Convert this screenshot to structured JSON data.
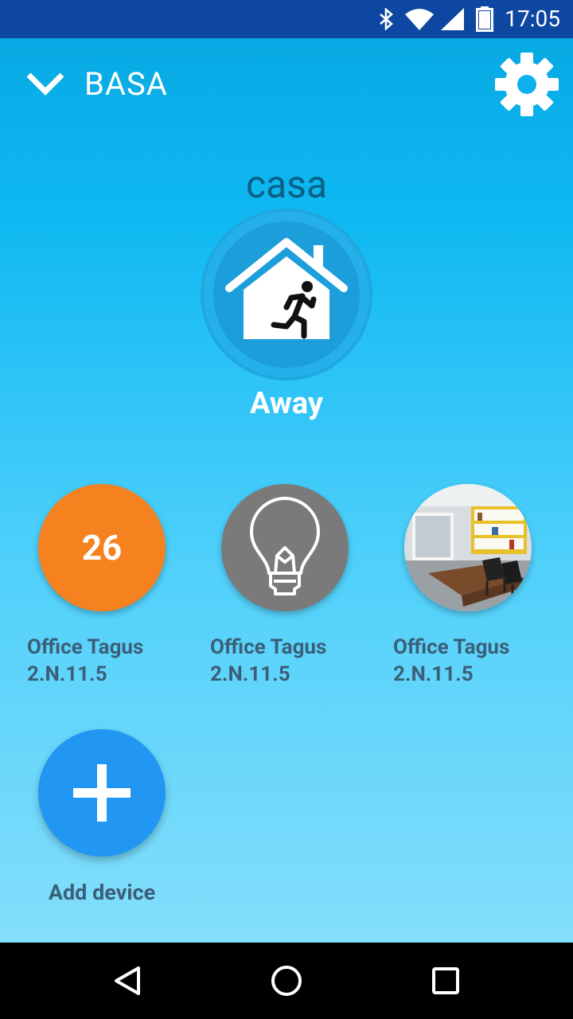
{
  "status_bar": {
    "time": "17:05"
  },
  "header": {
    "home_name": "BASA"
  },
  "place": {
    "name": "casa",
    "mode_label": "Away"
  },
  "devices": [
    {
      "kind": "temperature",
      "value": "26",
      "label_line1": "Office Tagus",
      "label_line2": "2.N.11.5",
      "color": "#f5821f"
    },
    {
      "kind": "light",
      "icon": "lightbulb-icon",
      "label_line1": "Office Tagus",
      "label_line2": "2.N.11.5",
      "color": "#7a7a7a"
    },
    {
      "kind": "camera",
      "icon": "office-photo",
      "label_line1": "Office Tagus",
      "label_line2": "2.N.11.5"
    }
  ],
  "add_device": {
    "label": "Add device",
    "color": "#2196f3"
  },
  "colors": {
    "status_bar": "#0d47a1",
    "accent_blue": "#2196f3",
    "label_text": "#3b5f78"
  }
}
